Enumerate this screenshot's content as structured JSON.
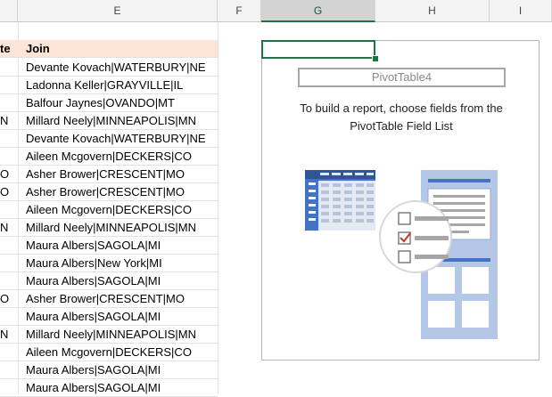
{
  "columns": {
    "d_partial": "",
    "e": "E",
    "f": "F",
    "g": "G",
    "h": "H",
    "i": "I"
  },
  "table": {
    "header_left": "te",
    "header_join": "Join",
    "rows": [
      {
        "left": "",
        "join": "Devante Kovach|WATERBURY|NE"
      },
      {
        "left": "",
        "join": "Ladonna Keller|GRAYVILLE|IL"
      },
      {
        "left": "",
        "join": "Balfour Jaynes|OVANDO|MT"
      },
      {
        "left": "N",
        "join": "Millard Neely|MINNEAPOLIS|MN"
      },
      {
        "left": "",
        "join": "Devante Kovach|WATERBURY|NE"
      },
      {
        "left": "",
        "join": "Aileen Mcgovern|DECKERS|CO"
      },
      {
        "left": "O",
        "join": "Asher Brower|CRESCENT|MO"
      },
      {
        "left": "O",
        "join": "Asher Brower|CRESCENT|MO"
      },
      {
        "left": "",
        "join": "Aileen Mcgovern|DECKERS|CO"
      },
      {
        "left": "N",
        "join": "Millard Neely|MINNEAPOLIS|MN"
      },
      {
        "left": "",
        "join": "Maura Albers|SAGOLA|MI"
      },
      {
        "left": "",
        "join": "Maura Albers|New York|MI"
      },
      {
        "left": "",
        "join": "Maura Albers|SAGOLA|MI"
      },
      {
        "left": "O",
        "join": "Asher Brower|CRESCENT|MO"
      },
      {
        "left": "",
        "join": "Maura Albers|SAGOLA|MI"
      },
      {
        "left": "N",
        "join": "Millard Neely|MINNEAPOLIS|MN"
      },
      {
        "left": "",
        "join": "Aileen Mcgovern|DECKERS|CO"
      },
      {
        "left": "",
        "join": "Maura Albers|SAGOLA|MI"
      },
      {
        "left": "",
        "join": "Maura Albers|SAGOLA|MI"
      }
    ]
  },
  "pivot": {
    "name": "PivotTable4",
    "message_line1": "To build a report, choose fields from the",
    "message_line2": "PivotTable Field List"
  },
  "colors": {
    "accent": "#217346",
    "header_fill": "#fce4d6",
    "illustration_blue": "#4472c4"
  },
  "icons": {
    "pivot_illustration": "pivot-field-list-illustration"
  }
}
